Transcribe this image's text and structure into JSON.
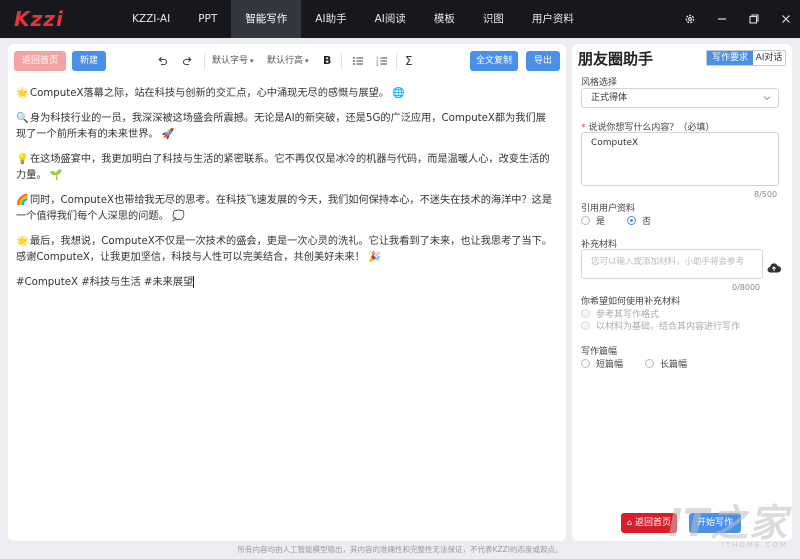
{
  "app": {
    "logo": "Kzzi"
  },
  "nav": {
    "items": [
      "KZZI-AI",
      "PPT",
      "智能写作",
      "AI助手",
      "AI阅读",
      "模板",
      "识图",
      "用户资料"
    ],
    "active_index": 2
  },
  "window_controls": {
    "icons": [
      "gear-icon",
      "minimize-icon",
      "restore-icon",
      "close-icon"
    ]
  },
  "editor": {
    "toolbar": {
      "home_label": "返回首页",
      "new_label": "新建",
      "font_size": "默认字号",
      "line_height": "默认行高",
      "bold": "B",
      "sigma": "Σ",
      "copy_all_label": "全文复制",
      "export_label": "导出"
    },
    "paragraphs": [
      {
        "emoji": "🌟",
        "text": "ComputeX落幕之际，站在科技与创新的交汇点，心中涌现无尽的感慨与展望。",
        "tail": "🌐"
      },
      {
        "emoji": "🔍",
        "text": "身为科技行业的一员，我深深被这场盛会所震撼。无论是AI的新突破，还是5G的广泛应用，ComputeX都为我们展现了一个前所未有的未来世界。",
        "tail": "🚀"
      },
      {
        "emoji": "💡",
        "text": "在这场盛宴中，我更加明白了科技与生活的紧密联系。它不再仅仅是冰冷的机器与代码，而是温暖人心，改变生活的力量。",
        "tail": "🌱"
      },
      {
        "emoji": "🌈",
        "text": "同时，ComputeX也带给我无尽的思考。在科技飞速发展的今天，我们如何保持本心，不迷失在技术的海洋中？这是一个值得我们每个人深思的问题。",
        "tail": "💭"
      },
      {
        "emoji": "🌟",
        "text": "最后，我想说，ComputeX不仅是一次技术的盛会，更是一次心灵的洗礼。它让我看到了未来，也让我思考了当下。感谢ComputeX，让我更加坚信，科技与人性可以完美结合，共创美好未来！",
        "tail": "🎉"
      }
    ],
    "hashtags": "#ComputeX #科技与生活 #未来展望"
  },
  "panel": {
    "title": "朋友圈助手",
    "tabs": [
      "写作要求",
      "AI对话"
    ],
    "style_label": "风格选择",
    "style_value": "正式得体",
    "content_label": "说说你想写什么内容？（必填）",
    "content_required": "*",
    "content_value": "ComputeX",
    "content_count": "8/500",
    "quote_label": "引用用户资料",
    "quote_yes": "是",
    "quote_no": "否",
    "supp_label": "补充材料",
    "supp_placeholder": "您可以输入或添加材料，小助手将会参考",
    "supp_count": "0/8000",
    "use_label": "你希望如何使用补充材料",
    "use_opt1": "参考其写作格式",
    "use_opt2": "以材料为基础，结合其内容进行写作",
    "length_label": "写作篇幅",
    "length_short": "短篇幅",
    "length_long": "长篇幅",
    "home_label": "返回首页",
    "write_label": "开始写作"
  },
  "footer": "所有内容均由人工智能模型输出，其内容的准确性和完整性无法保证，不代表KZZI的态度或观点。",
  "watermark": {
    "big": "IT之家",
    "small": "ITHOME.COM"
  },
  "colors": {
    "accent": "#4a90e8",
    "brand_red": "#e0373f",
    "topbar": "#16181d"
  }
}
